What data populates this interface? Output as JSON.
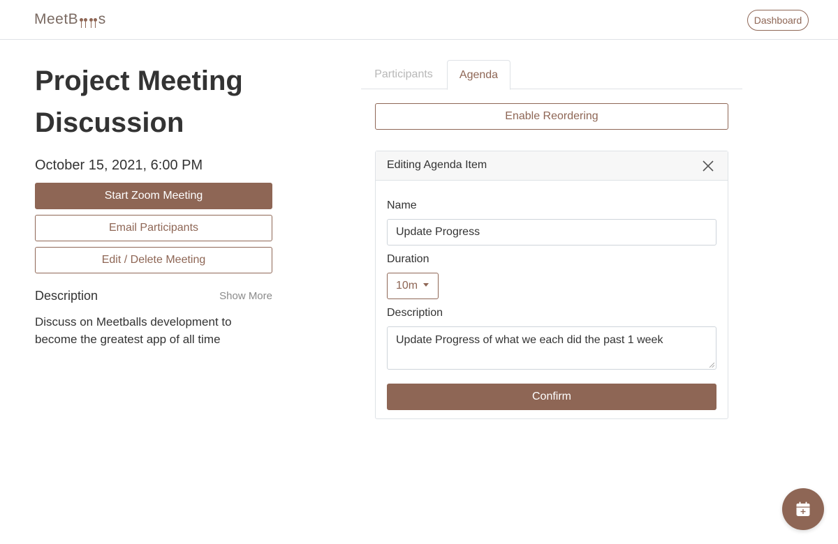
{
  "header": {
    "logo": {
      "prefix": "MeetB",
      "suffix": "s"
    },
    "dashboard_label": "Dashboard"
  },
  "meeting": {
    "title": "Project Meeting Discussion",
    "datetime": "October 15, 2021, 6:00 PM",
    "start_zoom_label": "Start Zoom Meeting",
    "email_label": "Email Participants",
    "edit_label": "Edit / Delete Meeting",
    "description_label": "Description",
    "show_more_label": "Show More",
    "description": "Discuss on Meetballs development to become the greatest app of all time"
  },
  "tabs": [
    {
      "label": "Participants",
      "active": false
    },
    {
      "label": "Agenda",
      "active": true
    }
  ],
  "agenda": {
    "reorder_label": "Enable Reordering",
    "edit_card": {
      "title": "Editing Agenda Item",
      "name_label": "Name",
      "name_value": "Update Progress",
      "duration_label": "Duration",
      "duration_value": "10m",
      "description_label": "Description",
      "description_value": "Update Progress of what we each did the past 1 week",
      "confirm_label": "Confirm"
    }
  },
  "fab": {
    "icon": "calendar-plus-icon"
  },
  "colors": {
    "accent": "#8e6655",
    "border": "#dee2e6",
    "muted": "#b8b8b8"
  }
}
